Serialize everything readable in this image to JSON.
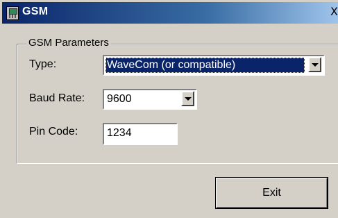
{
  "window": {
    "title": "GSM",
    "close_glyph": "X",
    "icon": "gsm-phone-icon"
  },
  "group": {
    "legend": "GSM Parameters"
  },
  "fields": {
    "type_label": "Type:",
    "type_value": "WaveCom (or compatible)",
    "baud_label": "Baud Rate:",
    "baud_value": "9600",
    "pin_label": "Pin Code:",
    "pin_value": "1234"
  },
  "buttons": {
    "exit_label": "Exit"
  },
  "colors": {
    "title_bar_start": "#0a246a",
    "title_bar_end": "#a6caf0",
    "dialog_face": "#d4d0c8",
    "selection": "#0a246a"
  }
}
